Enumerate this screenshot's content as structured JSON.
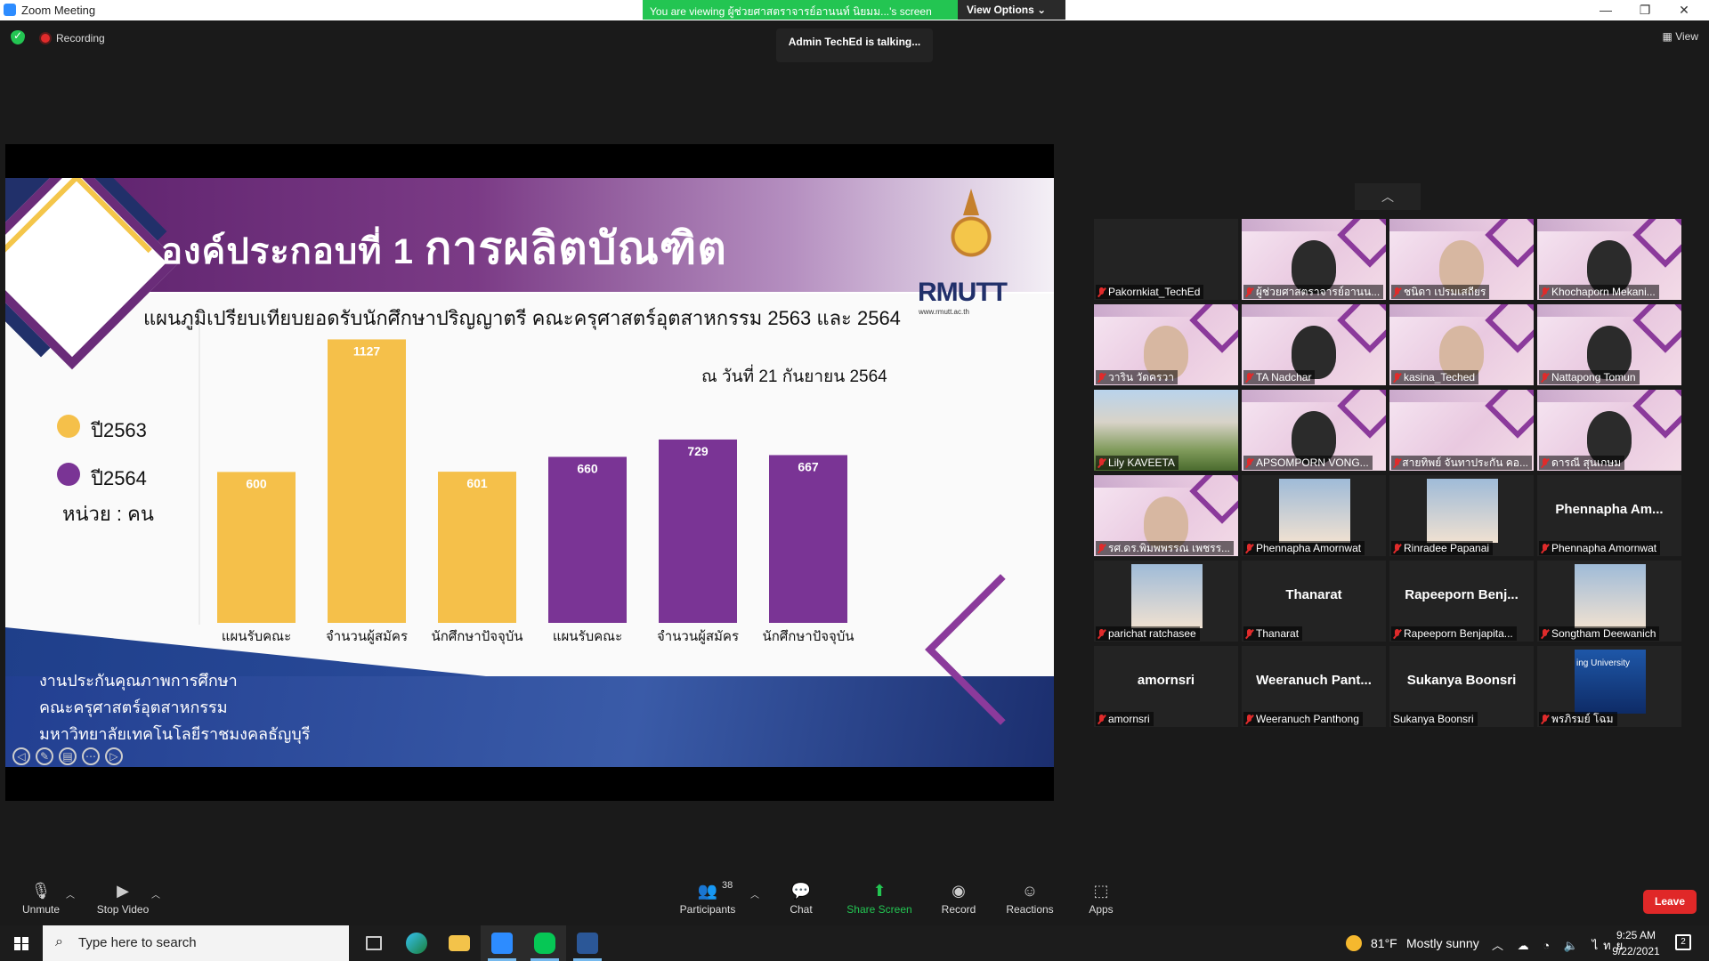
{
  "window": {
    "title": "Zoom Meeting"
  },
  "share_banner": {
    "message": "You are viewing ผู้ช่วยศาสตราจารย์อานนท์ นิยมม...'s screen",
    "view_options": "View Options ⌄"
  },
  "status": {
    "recording": "Recording",
    "talking": "Admin TechEd is talking...",
    "view": "View"
  },
  "slide": {
    "title_prefix": "องค์ประกอบที่ 1",
    "title_main": "การผลิตบัณฑิต",
    "logo_name": "RMUTT",
    "logo_site": "www.rmutt.ac.th",
    "subtitle": "แผนภูมิเปรียบเทียบยอดรับนักศึกษาปริญญาตรี คณะครุศาสตร์อุตสาหกรรม 2563 และ 2564",
    "date": "ณ วันที่  21 กันยายน  2564",
    "legend": [
      {
        "label": "ปี2563",
        "color": "#f5c04a"
      },
      {
        "label": "ปี2564",
        "color": "#7a3495"
      }
    ],
    "unit": "หน่วย : คน",
    "footer": [
      "งานประกันคุณภาพการศึกษา",
      "คณะครุศาสตร์อุตสาหกรรม",
      "มหาวิทยาลัยเทคโนโลยีราชมงคลธัญบุรี"
    ]
  },
  "chart_data": {
    "type": "bar",
    "categories": [
      "แผนรับคณะ",
      "จำนวนผู้สมัคร",
      "นักศึกษาปัจจุบัน",
      "แผนรับคณะ",
      "จำนวนผู้สมัคร",
      "นักศึกษาปัจจุบัน"
    ],
    "series": [
      {
        "name": "ปี2563",
        "values": [
          600,
          1127,
          601,
          null,
          null,
          null
        ],
        "color": "#f5c04a"
      },
      {
        "name": "ปี2564",
        "values": [
          null,
          null,
          null,
          660,
          729,
          667
        ],
        "color": "#7a3495"
      }
    ],
    "ylim": [
      0,
      1200
    ],
    "grid": false,
    "legend_position": "left"
  },
  "gallery": {
    "tiles": [
      {
        "name": "Pakornkiat_TechEd",
        "muted": true,
        "kind": "blank"
      },
      {
        "name": "ผู้ช่วยศาสตราจารย์อานน...",
        "muted": true,
        "kind": "slide-face-dark"
      },
      {
        "name": "ชนิดา เปรมเสถียร",
        "muted": true,
        "kind": "slide-face-light"
      },
      {
        "name": "Khochaporn Mekani...",
        "muted": true,
        "kind": "slide-face-dark"
      },
      {
        "name": "วาริน วัดครวา",
        "muted": true,
        "kind": "slide-face-light"
      },
      {
        "name": "TA Nadchar",
        "muted": true,
        "kind": "slide-face-dark"
      },
      {
        "name": "kasina_Teched",
        "muted": true,
        "kind": "slide-face-light"
      },
      {
        "name": "Nattapong Tomun",
        "muted": true,
        "kind": "slide-face-dark"
      },
      {
        "name": "Lily KAVEETA",
        "muted": true,
        "kind": "building"
      },
      {
        "name": "APSOMPORN VONG...",
        "muted": true,
        "kind": "slide-face-dark"
      },
      {
        "name": "สายทิพย์ จันทาประกัน คอ...",
        "muted": true,
        "kind": "slide"
      },
      {
        "name": "ดารณี สุนเกษม",
        "muted": true,
        "kind": "slide-face-dark"
      },
      {
        "name": "รศ.ดร.พิมพพรรณ เพชรร...",
        "muted": true,
        "kind": "slide-face-light"
      },
      {
        "name": "Phennapha Amornwat",
        "muted": true,
        "kind": "photo"
      },
      {
        "name": "Rinradee Papanai",
        "muted": true,
        "kind": "photo"
      },
      {
        "name": "Phennapha Amornwat",
        "muted": true,
        "kind": "name",
        "big": "Phennapha  Am..."
      },
      {
        "name": "parichat ratchasee",
        "muted": true,
        "kind": "photo"
      },
      {
        "name": "Thanarat",
        "muted": true,
        "kind": "name",
        "big": "Thanarat"
      },
      {
        "name": "Rapeeporn Benjapita...",
        "muted": true,
        "kind": "name",
        "big": "Rapeeporn  Benj..."
      },
      {
        "name": "Songtham Deewanich",
        "muted": true,
        "kind": "photo"
      },
      {
        "name": "amornsri",
        "muted": true,
        "kind": "name",
        "big": "amornsri"
      },
      {
        "name": "Weeranuch Panthong",
        "muted": true,
        "kind": "name",
        "big": "Weeranuch  Pant..."
      },
      {
        "name": "Sukanya Boonsri",
        "muted": false,
        "kind": "name",
        "big": "Sukanya Boonsri"
      },
      {
        "name": "พรภิรมย์ โฉม",
        "muted": true,
        "kind": "photo-blue",
        "photo_text": "ing University"
      }
    ]
  },
  "toolbar": {
    "unmute": "Unmute",
    "stop_video": "Stop Video",
    "participants": "Participants",
    "participants_count": "38",
    "chat": "Chat",
    "share_screen": "Share Screen",
    "record": "Record",
    "reactions": "Reactions",
    "apps": "Apps",
    "leave": "Leave"
  },
  "taskbar": {
    "search_placeholder": "Type here to search",
    "weather_temp": "81°F",
    "weather_desc": "Mostly sunny",
    "ime": "ไทย",
    "time": "9:25 AM",
    "date": "9/22/2021",
    "notifications": "2"
  }
}
